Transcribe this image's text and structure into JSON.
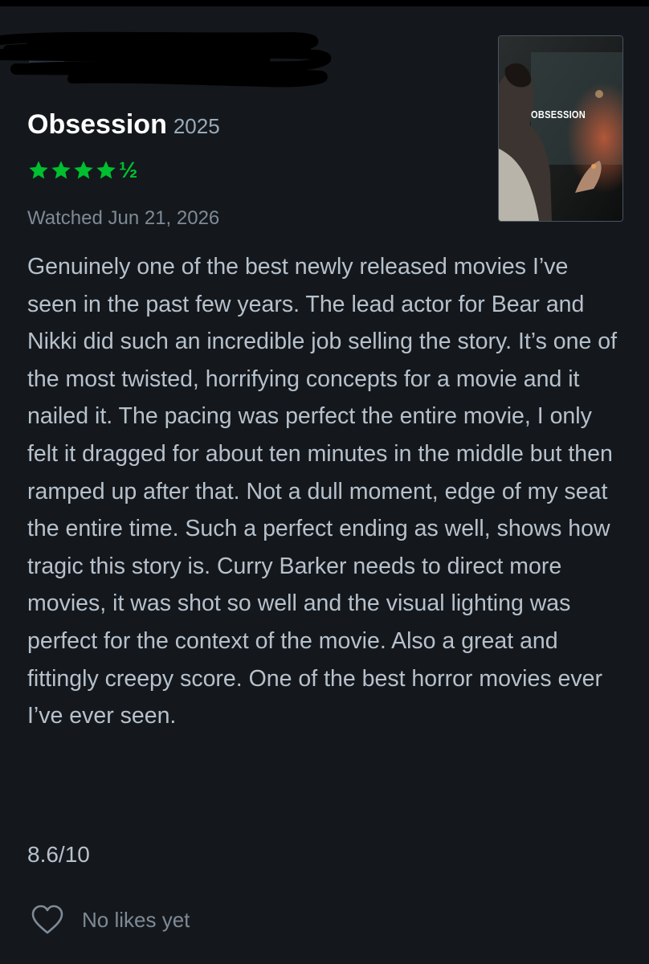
{
  "review": {
    "title": "Obsession",
    "year": "2025",
    "rating": {
      "stars": 4.5,
      "max": 5,
      "half_glyph": "½",
      "color": "#00c030"
    },
    "watched": "Watched Jun 21, 2026",
    "body": "Genuinely one of the best newly released movies I’ve seen in the past few years. The lead actor for Bear and Nikki did such an incredible job selling the story. It’s one of the most twisted, horrifying concepts for a movie and it nailed it. The pacing was perfect the entire movie, I only felt it dragged for about ten minutes in the middle but then ramped up after that. Not a dull moment, edge of my seat the entire time. Such a perfect ending as well, shows how tragic this story is. Curry Barker needs to direct more movies, it was shot so well and the visual lighting was perfect for the context of the movie. Also a great and fittingly creepy score. One of the best horror movies ever I’ve ever seen.",
    "score": "8.6/10",
    "likes_label": "No likes yet"
  },
  "poster": {
    "title_text": "OBSESSION"
  },
  "icons": {
    "like": "heart-outline-icon",
    "rating": "star-icon"
  }
}
